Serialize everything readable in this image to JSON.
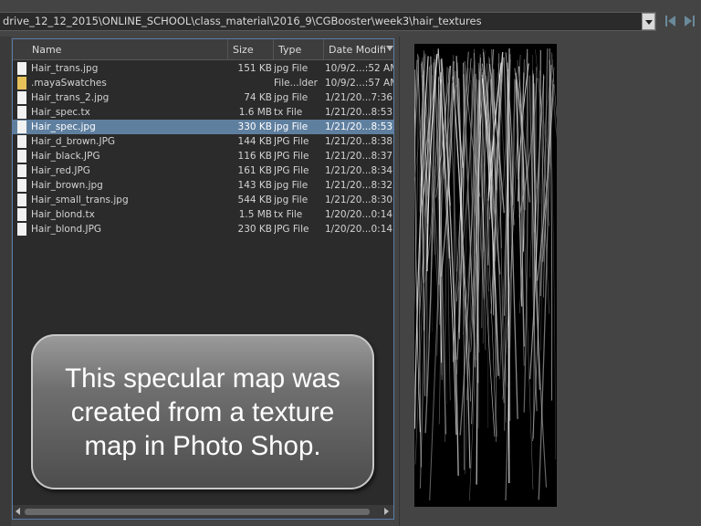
{
  "path_bar": {
    "path": "drive_12_12_2015\\ONLINE_SCHOOL\\class_material\\2016_9\\CGBooster\\week3\\hair_textures",
    "dropdown_icon": "chevron-down-icon",
    "back_icon": "nav-back-icon",
    "forward_icon": "nav-forward-icon"
  },
  "file_list": {
    "columns": {
      "name": "Name",
      "size": "Size",
      "type": "Type",
      "date": "Date Modifi"
    },
    "rows": [
      {
        "name": "Hair_trans.jpg",
        "size": "151 KB",
        "type": "jpg File",
        "date": "10/9/2...:52 AM",
        "icon": "file-icon",
        "selected": false
      },
      {
        "name": ".mayaSwatches",
        "size": "",
        "type": "File...lder",
        "date": "10/9/2...:57 AM",
        "icon": "folder-icon",
        "selected": false
      },
      {
        "name": "Hair_trans_2.jpg",
        "size": "74 KB",
        "type": "jpg File",
        "date": "1/21/20...7:36 P",
        "icon": "file-icon",
        "selected": false
      },
      {
        "name": "Hair_spec.tx",
        "size": "1.6 MB",
        "type": "tx File",
        "date": "1/21/20...8:53 P",
        "icon": "file-icon",
        "selected": false
      },
      {
        "name": "Hair_spec.jpg",
        "size": "330 KB",
        "type": "jpg File",
        "date": "1/21/20...8:53 P",
        "icon": "file-icon",
        "selected": true
      },
      {
        "name": "Hair_d_brown.JPG",
        "size": "144 KB",
        "type": "JPG File",
        "date": "1/21/20...8:38 P",
        "icon": "file-icon",
        "selected": false
      },
      {
        "name": "Hair_black.JPG",
        "size": "116 KB",
        "type": "JPG File",
        "date": "1/21/20...8:37 P",
        "icon": "file-icon",
        "selected": false
      },
      {
        "name": "Hair_red.JPG",
        "size": "161 KB",
        "type": "JPG File",
        "date": "1/21/20...8:34 P",
        "icon": "file-icon",
        "selected": false
      },
      {
        "name": "Hair_brown.jpg",
        "size": "143 KB",
        "type": "jpg File",
        "date": "1/21/20...8:32 P",
        "icon": "file-icon",
        "selected": false
      },
      {
        "name": "Hair_small_trans.jpg",
        "size": "544 KB",
        "type": "jpg File",
        "date": "1/21/20...8:30 P",
        "icon": "file-icon",
        "selected": false
      },
      {
        "name": "Hair_blond.tx",
        "size": "1.5 MB",
        "type": "tx File",
        "date": "1/20/20...0:14 P",
        "icon": "file-icon",
        "selected": false
      },
      {
        "name": "Hair_blond.JPG",
        "size": "230 KB",
        "type": "JPG File",
        "date": "1/20/20...0:14 P",
        "icon": "file-icon",
        "selected": false
      }
    ]
  },
  "callout": {
    "text": "This specular map was created from a texture map in Photo Shop."
  },
  "colors": {
    "selection": "#5f7f9f",
    "panel_border": "#5b7da8",
    "folder": "#e6c15a"
  }
}
